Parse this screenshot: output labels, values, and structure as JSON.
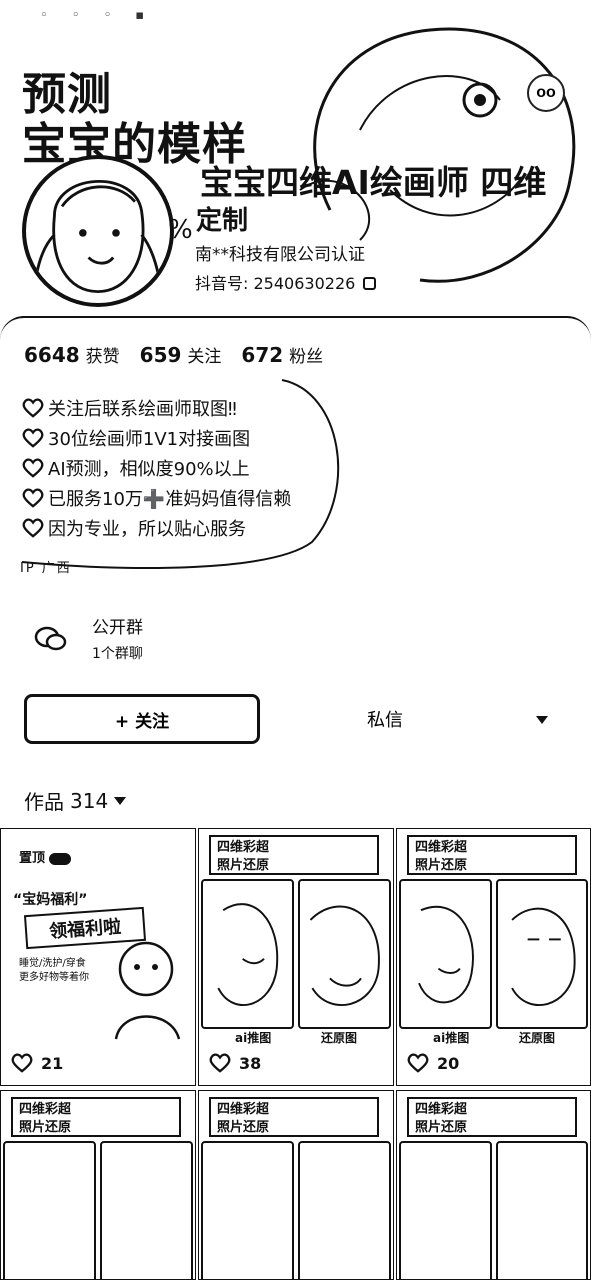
{
  "status_bar": {
    "icons": "◦ ◦ ◦ ▪"
  },
  "banner": {
    "headline_line1": "预测",
    "headline_line2": "宝宝的模样",
    "percent_fragment": "%",
    "profile_name": "宝宝四维AI绘画师",
    "profile_name_suffix": "四维",
    "profile_name_line2": "定制",
    "company": "南**科技有限公司认证",
    "douyin_id_label": "抖音号:",
    "douyin_id_value": "2540630226",
    "top_right_label": "oo"
  },
  "stats": [
    {
      "value": "6648",
      "label": "获赞"
    },
    {
      "value": "659",
      "label": "关注"
    },
    {
      "value": "672",
      "label": "粉丝"
    }
  ],
  "bio": [
    "关注后联系绘画师取图‼",
    "30位绘画师1V1对接画图",
    "AI预测，相似度90%以上",
    "已服务10万➕准妈妈值得信赖",
    "因为专业，所以贴心服务"
  ],
  "partial_row": "IP 广西",
  "group": {
    "title": "公开群",
    "subtitle": "1个群聊"
  },
  "actions": {
    "follow": "+ 关注",
    "message": "私信"
  },
  "works": {
    "label": "作品",
    "count": "314"
  },
  "tiles": [
    {
      "pinned_label": "置顶",
      "promo_title": "“宝妈福利”",
      "promo_stamp": "领福利啦",
      "promo_sub": "睡觉/洗护/穿食\n更多好物等着你",
      "likes": "21"
    },
    {
      "header": "四维彩超\n照片还原",
      "left_caption": "ai推图",
      "right_caption": "还原图",
      "likes": "38"
    },
    {
      "header": "四维彩超\n照片还原",
      "left_caption": "ai推图",
      "right_caption": "还原图",
      "likes": "20"
    },
    {
      "header": "四维彩超\n照片还原"
    },
    {
      "header": "四维彩超\n照片还原"
    },
    {
      "header": "四维彩超\n照片还原"
    }
  ],
  "colors": {
    "ink": "#111111",
    "bg": "#ffffff"
  },
  "icons": [
    "heart-icon",
    "group-chat-icon",
    "chevron-down-icon",
    "copy-icon"
  ]
}
